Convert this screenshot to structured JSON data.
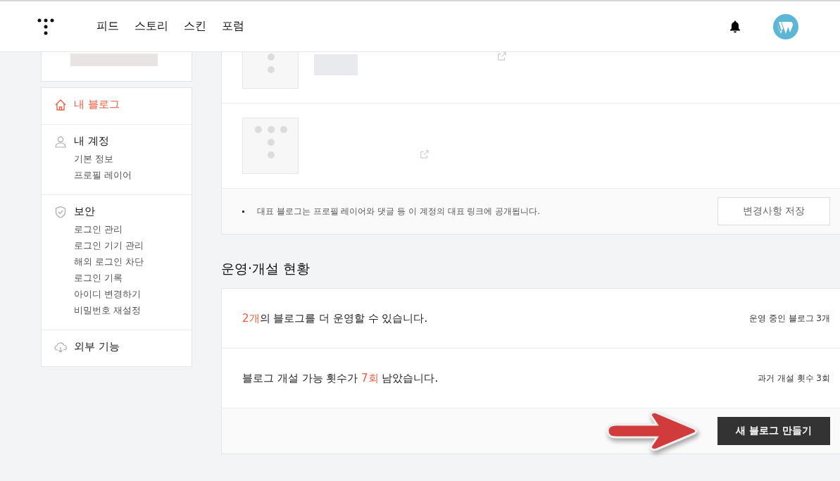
{
  "header": {
    "nav": [
      {
        "label": "피드",
        "selected": false
      },
      {
        "label": "스토리",
        "selected": false
      },
      {
        "label": "스킨",
        "selected": false
      },
      {
        "label": "포럼",
        "selected": false
      }
    ]
  },
  "sidebar": {
    "sections": [
      {
        "title": "내 블로그",
        "selected": true
      },
      {
        "title": "내 계정",
        "selected": false,
        "items": [
          "기본 정보",
          "프로필 레이어"
        ]
      },
      {
        "title": "보안",
        "selected": false,
        "items": [
          "로그인 관리",
          "로그인 기기 관리",
          "해외 로그인 차단",
          "로그인 기록",
          "아이디 변경하기",
          "비밀번호 재설정"
        ]
      },
      {
        "title": "외부 기능",
        "selected": false
      }
    ]
  },
  "blogs": [
    {
      "redacted": true
    },
    {
      "redacted": false
    }
  ],
  "notice": "대표 블로그는 프로필 레이어와 댓글 등 이 계정의 대표 링크에 공개됩니다.",
  "save_button": "변경사항 저장",
  "status_heading": "운영·개설 현황",
  "status_rows": [
    {
      "before": "",
      "highlight": "2개",
      "after": "의 블로그를 더 운영할 수 있습니다.",
      "side": "운영 중인 블로그 3개"
    },
    {
      "before": "블로그 개설 가능 횟수가 ",
      "highlight": "7회",
      "after": " 남았습니다.",
      "side": "과거 개설 횟수 3회"
    }
  ],
  "create_button": "새 블로그 만들기"
}
